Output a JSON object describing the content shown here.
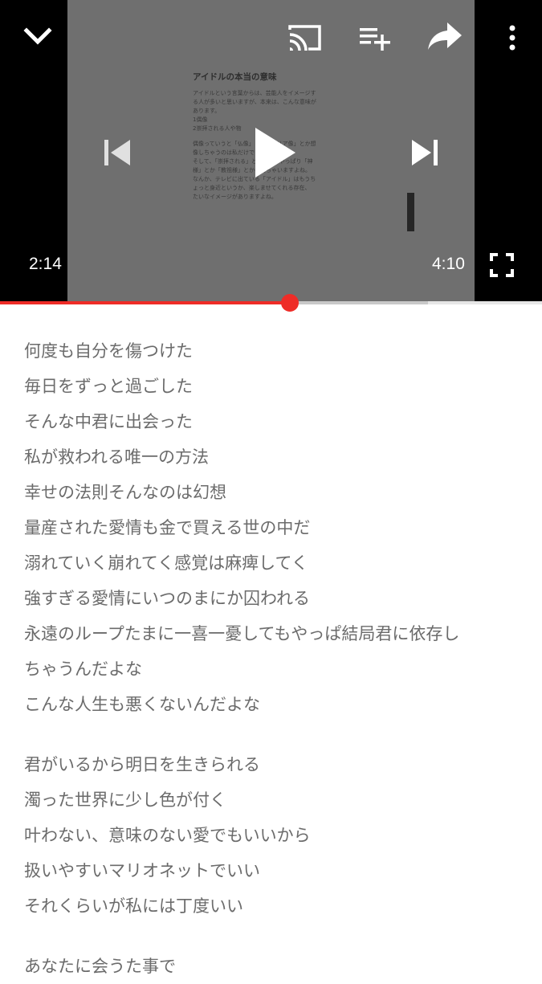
{
  "player": {
    "current_time": "2:14",
    "duration": "4:10",
    "progress_fraction": 0.535,
    "buffered_fraction": 0.79,
    "colors": {
      "accent": "#ee2c27",
      "frame": "#6f6f6f"
    },
    "icons": {
      "minimize": "chevron-down-icon",
      "cast": "cast-icon",
      "add_to_playlist": "playlist-add-icon",
      "share": "share-icon",
      "more": "more-vert-icon",
      "previous": "skip-previous-icon",
      "play": "play-icon",
      "next": "skip-next-icon",
      "fullscreen": "fullscreen-icon"
    },
    "frame_doc": {
      "title": "アイドルの本当の意味",
      "para1": [
        "アイドルという言葉からは、芸能人をイメージす",
        "る人が多いと思いますが、本来は、こんな意味が",
        "あります。",
        "1偶像",
        "2崇拝される人や物"
      ],
      "para2": [
        "偶像っていうと「仏像」とか「マリア像」とか想",
        "像しちゃうのは私だけでしょうかね〜",
        "そして、「崇拝される」となると、やっぱり「神",
        "様」とか「教祖様」とか考えちゃいますよね。",
        "なんか、テレビに出ている「アイドル」はもうち",
        "ょっと身近というか、楽しませてくれる存在、",
        "たいなイメージがありますよね。"
      ]
    }
  },
  "lyrics": {
    "stanza1": [
      "何度も自分を傷つけた",
      "毎日をずっと過ごした",
      "そんな中君に出会った",
      "私が救われる唯一の方法",
      "幸せの法則そんなのは幻想",
      "量産された愛情も金で買える世の中だ",
      "溺れていく崩れてく感覚は麻痺してく",
      "強すぎる愛情にいつのまにか囚われる",
      "永遠のループたまに一喜一憂してもやっぱ結局君に依存し",
      "ちゃうんだよな",
      "こんな人生も悪くないんだよな"
    ],
    "stanza2": [
      "君がいるから明日を生きられる",
      "濁った世界に少し色が付く",
      "叶わない、意味のない愛でもいいから",
      "扱いやすいマリオネットでいい",
      "それくらいが私には丁度いい"
    ],
    "stanza3": [
      "あなたに会うた事で"
    ]
  }
}
